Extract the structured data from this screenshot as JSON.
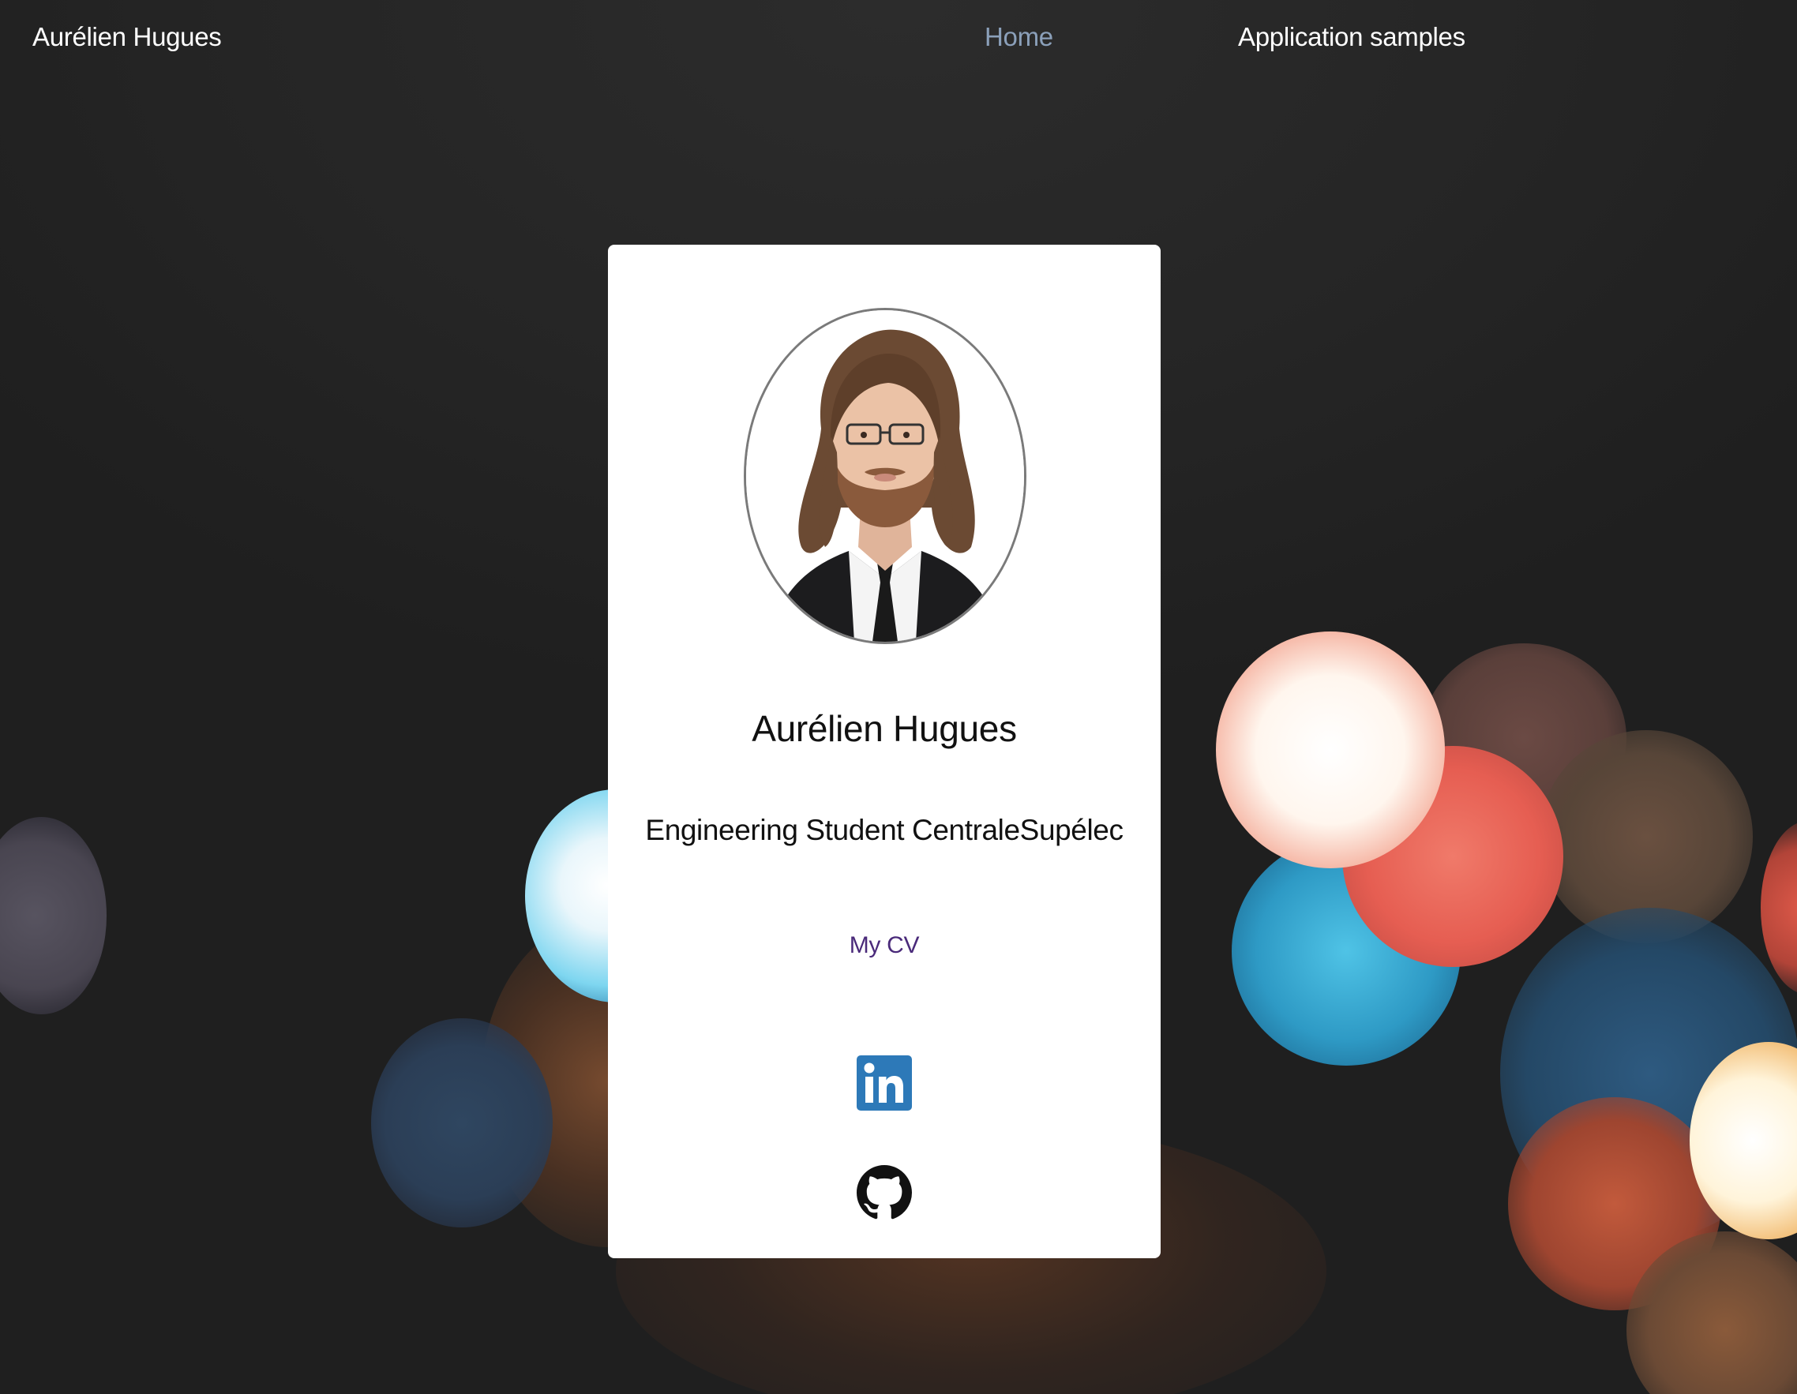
{
  "nav": {
    "brand": "Aurélien Hugues",
    "links": [
      {
        "label": "Home"
      },
      {
        "label": "Application samples"
      }
    ]
  },
  "card": {
    "name": "Aurélien Hugues",
    "subtitle": "Engineering Student CentraleSupélec",
    "cv_link": "My CV",
    "social": [
      {
        "icon": "linkedin-icon"
      },
      {
        "icon": "github-icon"
      }
    ]
  },
  "colors": {
    "background": "#262626",
    "nav_active": "#8ba0ba",
    "nav_text": "#ffffff",
    "card_background": "#ffffff",
    "cv_link": "#4a2a7a",
    "linkedin_blue": "#2d79b8"
  }
}
